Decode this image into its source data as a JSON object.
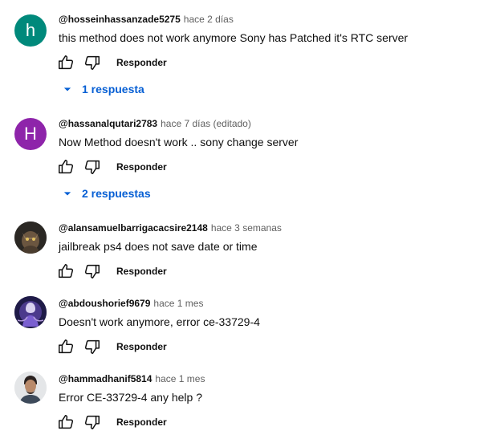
{
  "comments": [
    {
      "handle": "@hosseinhassanzade5275",
      "time": "hace 2 días",
      "text": "this method does not work anymore Sony has Patched it's RTC server",
      "avatar_letter": "h",
      "avatar_color": "#00897b",
      "reply_label": "Responder",
      "replies_label": "1 respuesta"
    },
    {
      "handle": "@hassanalqutari2783",
      "time": "hace 7 días (editado)",
      "text": "Now Method doesn't  work .. sony change server",
      "avatar_letter": "H",
      "avatar_color": "#8e24aa",
      "reply_label": "Responder",
      "replies_label": "2 respuestas"
    },
    {
      "handle": "@alansamuelbarrigacacsire2148",
      "time": "hace 3 semanas",
      "text": "jailbreak ps4 does not save date or time",
      "reply_label": "Responder"
    },
    {
      "handle": "@abdoushorief9679",
      "time": "hace 1 mes",
      "text": "Doesn't work anymore, error ce-33729-4",
      "reply_label": "Responder"
    },
    {
      "handle": "@hammadhanif5814",
      "time": "hace 1 mes",
      "text": "Error CE-33729-4 any help ?",
      "reply_label": "Responder"
    }
  ],
  "colors": {
    "link_blue": "#065fd4",
    "text_primary": "#0f0f0f",
    "text_secondary": "#606060"
  }
}
